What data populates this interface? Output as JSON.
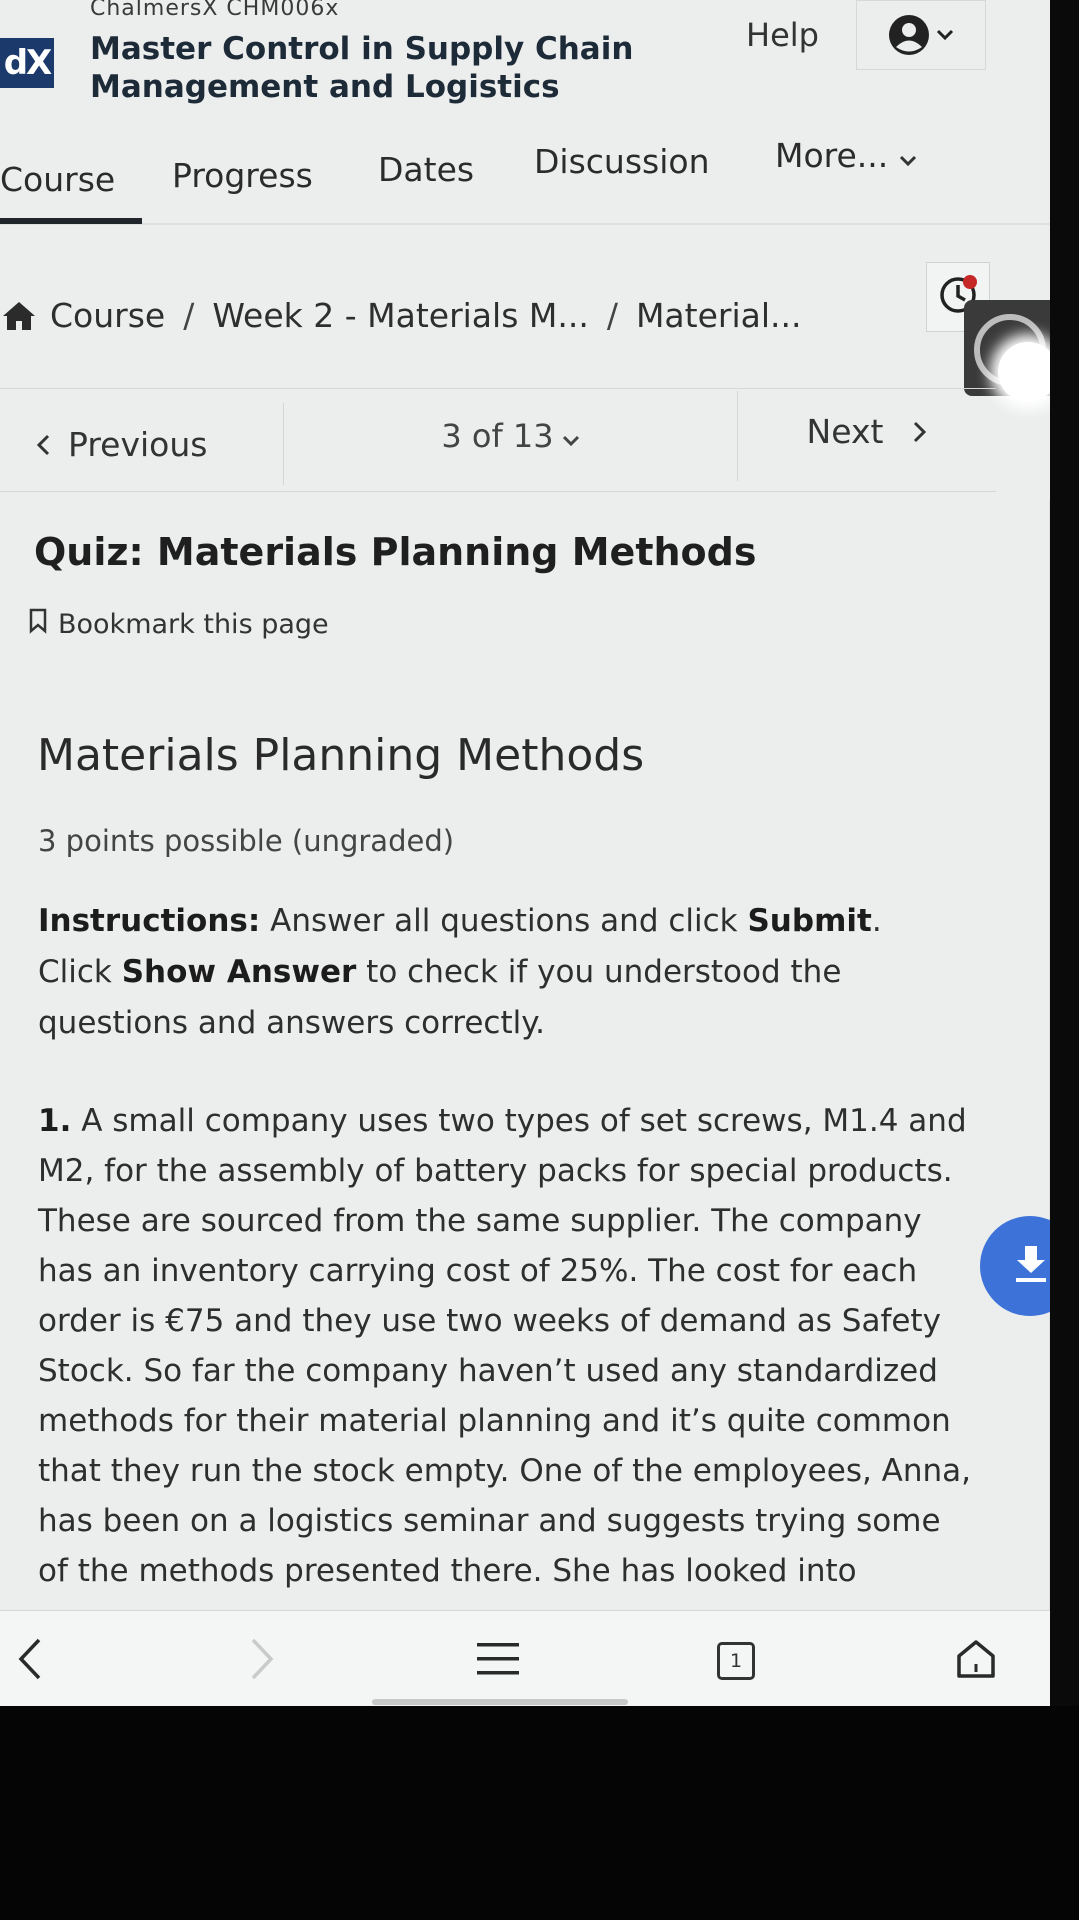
{
  "header": {
    "org_line": "ChalmersX CHM006x",
    "logo_text": "dX",
    "course_title": "Master Control in Supply Chain Management and Logistics",
    "help_label": "Help",
    "user_icon": "user-circle-icon"
  },
  "tabs": [
    {
      "label": "Course",
      "active": true
    },
    {
      "label": "Progress",
      "active": false
    },
    {
      "label": "Dates",
      "active": false
    },
    {
      "label": "Discussion",
      "active": false
    },
    {
      "label": "More...",
      "active": false
    }
  ],
  "breadcrumb": {
    "items": [
      "Course",
      "Week 2 - Materials M...",
      "Material..."
    ],
    "separator": "/"
  },
  "sequence_nav": {
    "previous_label": "Previous",
    "position_label": "3 of 13",
    "next_label": "Next"
  },
  "unit": {
    "title": "Quiz: Materials Planning Methods",
    "bookmark_label": "Bookmark this page"
  },
  "problem": {
    "title": "Materials Planning Methods",
    "points": "3 points possible (ungraded)",
    "instructions": {
      "label": "Instructions:",
      "text_1": " Answer all questions and click ",
      "submit": "Submit",
      "text_2": ". Click ",
      "show_answer": "Show Answer",
      "text_3": " to check if you understood the questions and answers correctly."
    },
    "question_1": {
      "number": "1.",
      "text": " A small company uses two types of set screws, M1.4 and M2, for the assembly of battery packs for special products. These are sourced from the same supplier. The company has an inventory carrying cost of 25%. The cost for each order is €75 and they use two weeks of demand as Safety Stock. So far the company haven’t used any standardized methods for their material planning and it’s quite common that they run the stock empty. One of the employees, Anna, has been on a logistics seminar and suggests trying some of the methods presented there. She has looked into"
    }
  },
  "browser_bar": {
    "tab_count": "1"
  },
  "colors": {
    "accent_blue": "#3d73d8",
    "notification_red": "#c62828",
    "logo_bg": "#1b3a6b",
    "active_tab_underline": "#20262b"
  }
}
